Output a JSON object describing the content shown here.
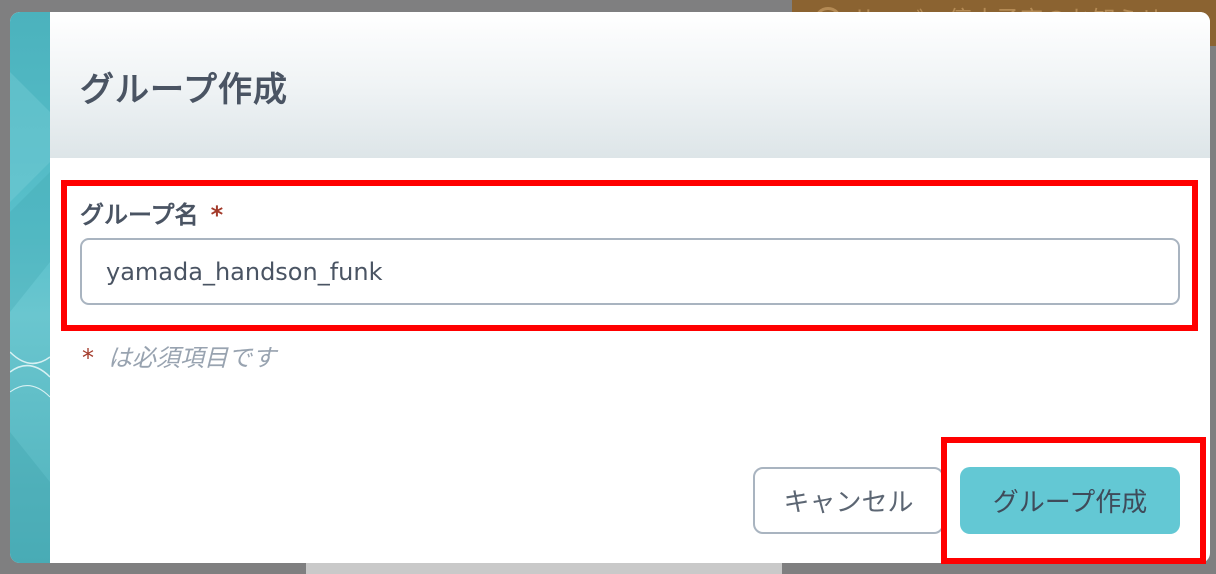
{
  "background": {
    "banner_text": "サーバー停止予定のお知らせ"
  },
  "dialog": {
    "title": "グループ作成",
    "field": {
      "label": "グループ名",
      "required_mark": "*",
      "value": "yamada_handson_funk"
    },
    "required_note": {
      "mark": "*",
      "text": "は必須項目です"
    },
    "buttons": {
      "cancel_label": "キャンセル",
      "create_label": "グループ作成"
    }
  },
  "colors": {
    "accent": "#63c8d4",
    "highlight": "#ff0000",
    "required": "#a33a2a",
    "text": "#4a5463"
  }
}
